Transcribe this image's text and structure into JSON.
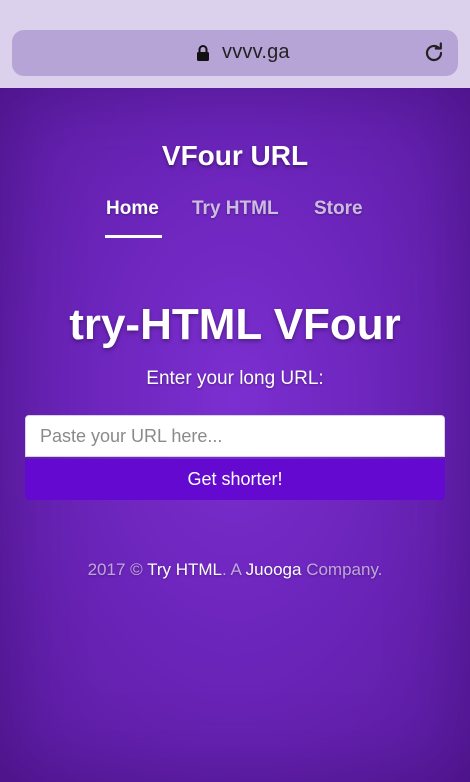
{
  "browser": {
    "url": "vvvv.ga"
  },
  "site": {
    "title": "VFour URL"
  },
  "nav": {
    "items": [
      {
        "label": "Home",
        "active": true
      },
      {
        "label": "Try HTML",
        "active": false
      },
      {
        "label": "Store",
        "active": false
      }
    ]
  },
  "hero": {
    "heading": "try-HTML VFour",
    "subheading": "Enter your long URL:"
  },
  "form": {
    "input_value": "",
    "input_placeholder": "Paste your URL here...",
    "submit_label": "Get shorter!"
  },
  "footer": {
    "prefix": "2017 ©",
    "link1": "Try HTML",
    "middle": ". A",
    "link2": "Juooga",
    "suffix": "Company."
  },
  "colors": {
    "background": "#6a25b3",
    "button": "#6409cf",
    "browser_bar": "#dcd1ec",
    "address_bar": "#b7a4d6"
  },
  "icons": [
    "lock-icon",
    "reload-icon"
  ]
}
